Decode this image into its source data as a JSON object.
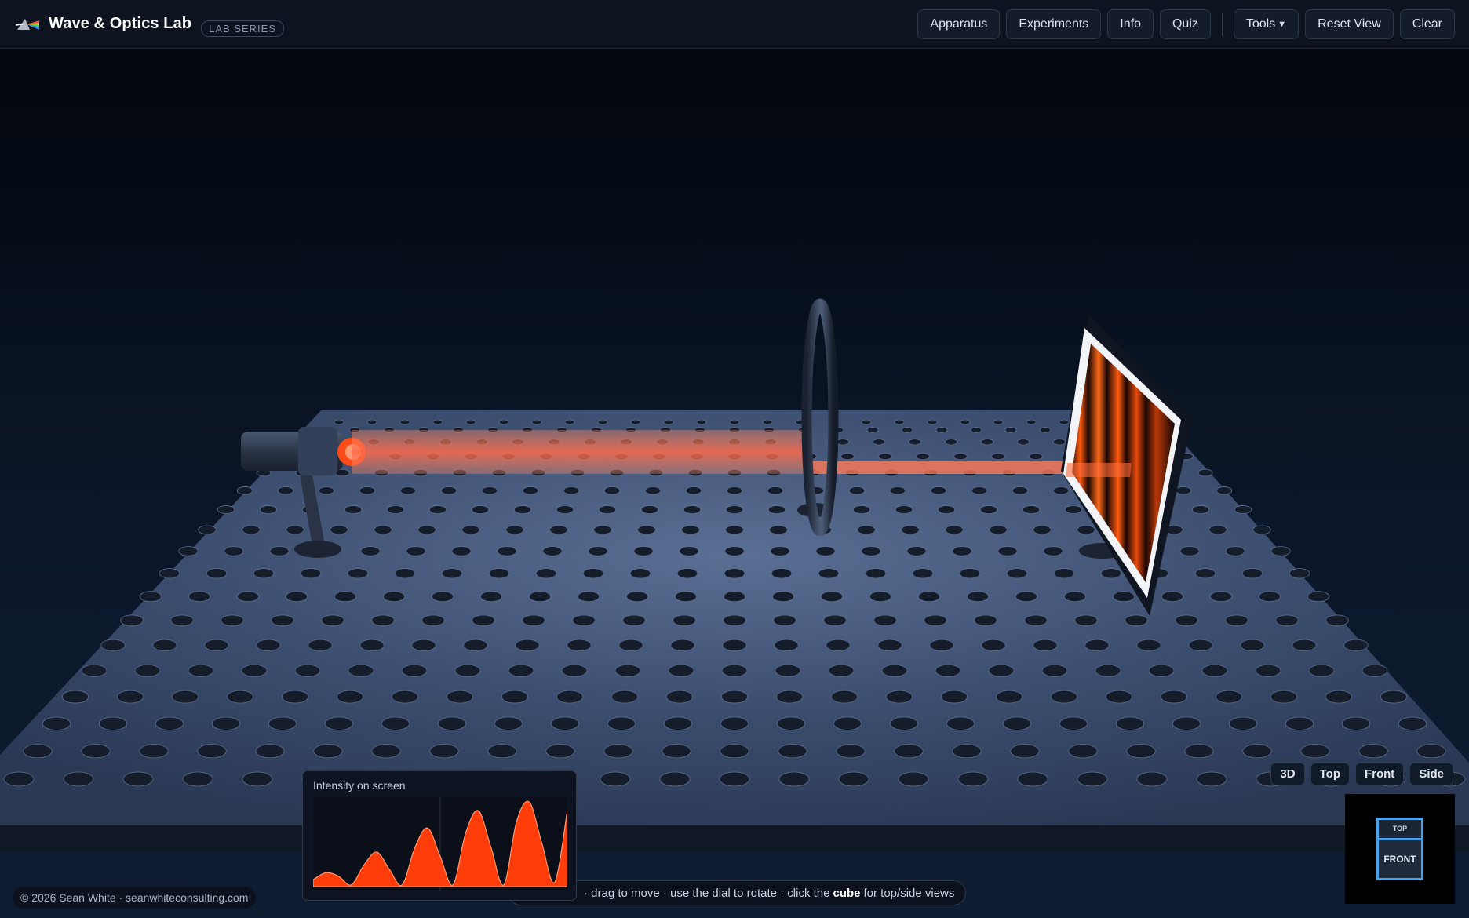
{
  "app": {
    "title": "Wave & Optics Lab",
    "badge": "LAB SERIES",
    "logo_icon": "prism-icon"
  },
  "nav": {
    "apparatus": "Apparatus",
    "experiments": "Experiments",
    "info": "Info",
    "quiz": "Quiz",
    "tools": "Tools",
    "tools_icon": "caret-down-icon",
    "reset_view": "Reset View",
    "clear": "Clear"
  },
  "scene": {
    "beam_color": "#ff4a1a",
    "fringe_color": "#ff5a10",
    "table_color": "#3a4d6e",
    "apparatus": [
      "laser",
      "ring-aperture",
      "screen"
    ]
  },
  "views": {
    "view_3d": "3D",
    "top": "Top",
    "front": "Front",
    "side": "Side"
  },
  "view_cube": {
    "top": "TOP",
    "front": "FRONT"
  },
  "intensity_panel": {
    "title": "Intensity on screen",
    "fill_color": "#ff3d0a"
  },
  "footer": {
    "credit": "© 2026 Sean White · seanwhiteconsulting.com",
    "hint_pre": "· drag to move · use the dial to rotate · click the",
    "hint_bold": "cube",
    "hint_post": "for top/side views"
  },
  "chart_data": {
    "type": "area",
    "title": "Intensity on screen",
    "xlabel": "",
    "ylabel": "",
    "x": [
      0.0,
      0.05,
      0.1,
      0.15,
      0.2,
      0.25,
      0.3,
      0.35,
      0.4,
      0.45,
      0.5,
      0.55,
      0.6,
      0.65,
      0.7,
      0.75,
      0.8,
      0.85,
      0.9,
      0.95,
      1.0
    ],
    "series": [
      {
        "values": [
          0.08,
          0.16,
          0.12,
          0.02,
          0.25,
          0.4,
          0.2,
          0.02,
          0.45,
          0.68,
          0.35,
          0.02,
          0.62,
          0.88,
          0.45,
          0.02,
          0.75,
          0.98,
          0.5,
          0.05,
          0.88
        ]
      }
    ],
    "ylim": [
      0,
      1
    ],
    "grid": false
  }
}
